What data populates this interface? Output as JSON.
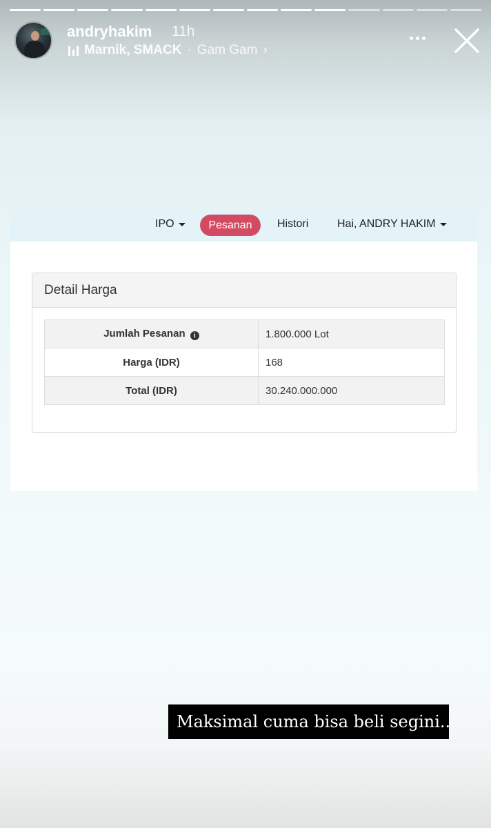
{
  "story": {
    "progress": [
      1,
      1,
      1,
      1,
      1,
      1,
      1,
      1,
      1,
      1,
      0,
      0,
      0,
      0
    ],
    "username": "andryhakim",
    "time": "11h",
    "music": {
      "artist": "Marnik, SMACK",
      "separator": "·",
      "track": "Gam Gam",
      "chevron": "›"
    },
    "caption": "Maksimal cuma bisa beli segini..."
  },
  "app": {
    "nav": {
      "ipo": "IPO",
      "pesanan": "Pesanan",
      "histori": "Histori",
      "user": "Hai, ANDRY HAKIM"
    },
    "panel": {
      "title": "Detail Harga",
      "rows": [
        {
          "label": "Jumlah Pesanan",
          "value": "1.800.000 Lot"
        },
        {
          "label": "Harga (IDR)",
          "value": "168"
        },
        {
          "label": "Total (IDR)",
          "value": "30.240.000.000"
        }
      ]
    },
    "colors": {
      "accent": "#d34b62",
      "navbar": "#e3f3f7"
    }
  }
}
